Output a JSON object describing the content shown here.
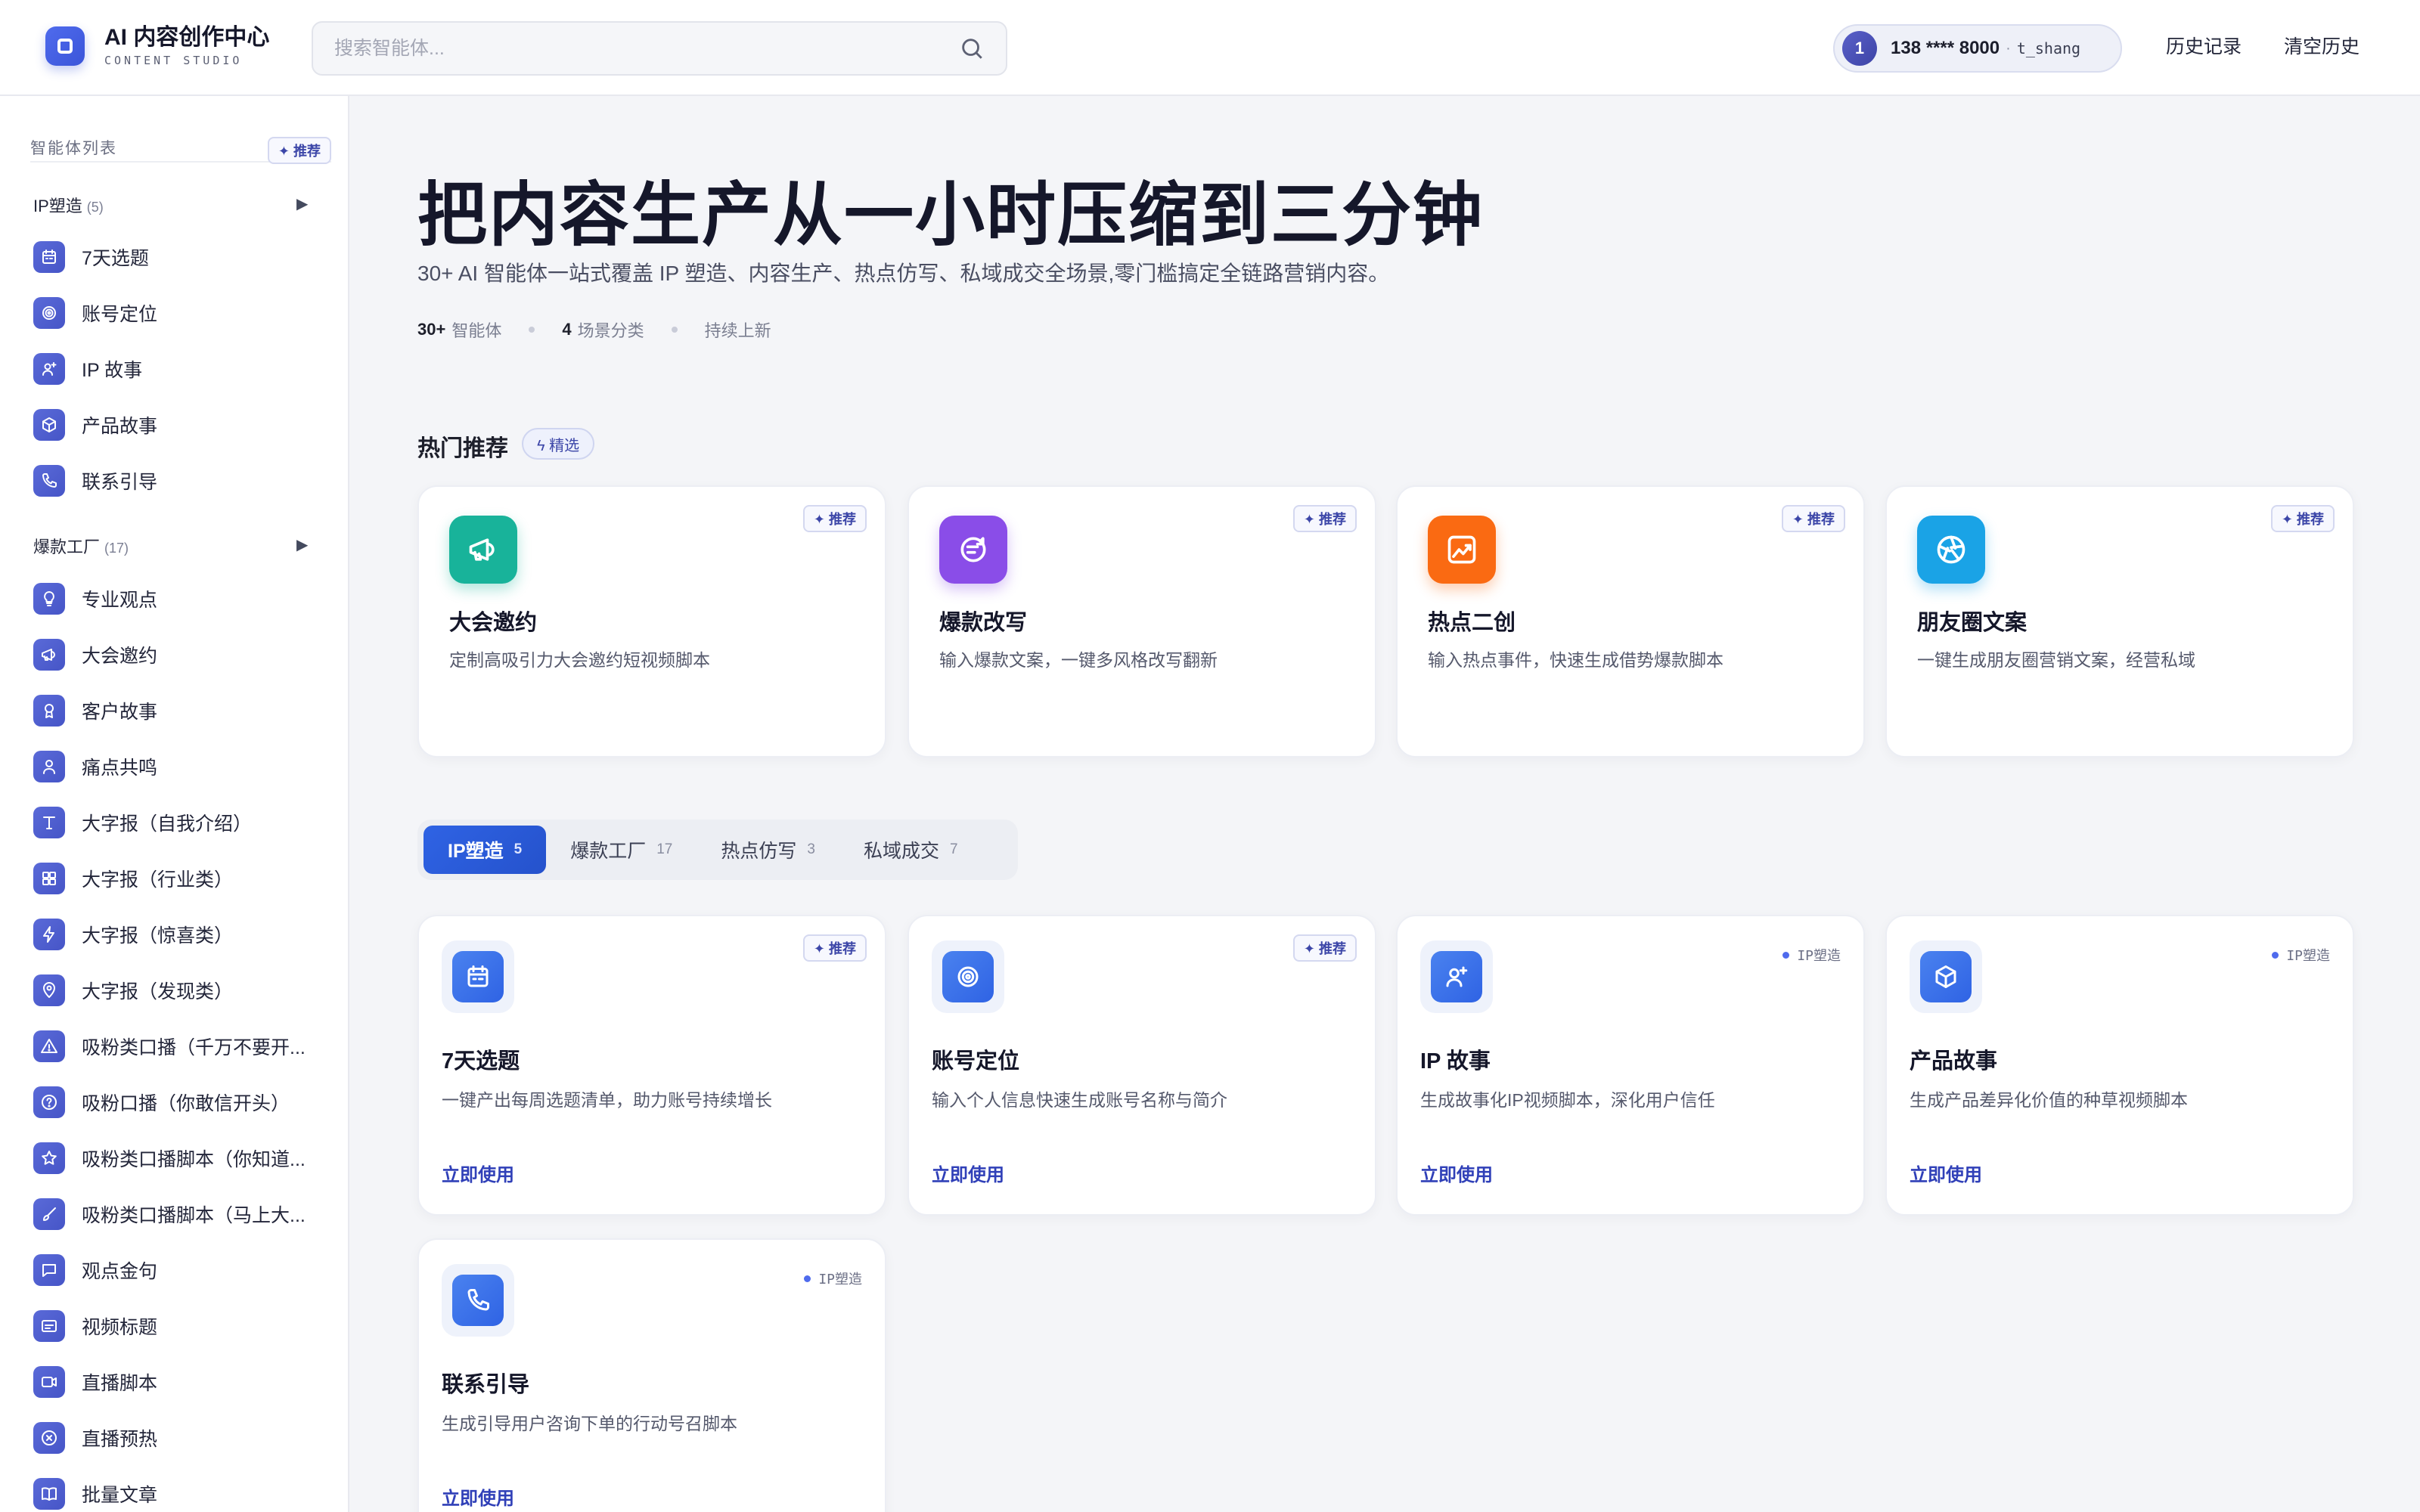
{
  "header": {
    "title": "AI 内容创作中心",
    "subtitle": "CONTENT STUDIO",
    "search_placeholder": "搜索智能体...",
    "user": {
      "avatar": "1",
      "phone": "138 **** 8000",
      "sep": "·",
      "name": "t_shang"
    },
    "history_label": "历史记录",
    "clear_label": "清空历史"
  },
  "sidebar": {
    "header_label": "智能体列表",
    "rec_label": "✦ 推荐",
    "groups": [
      {
        "label": "IP塑造",
        "count": "(5)",
        "arrow": "▶"
      },
      {
        "label": "爆款工厂",
        "count": "(17)",
        "arrow": "▶"
      }
    ],
    "ip_items": [
      {
        "label": "7天选题",
        "icon": "calendar-icon"
      },
      {
        "label": "账号定位",
        "icon": "target-icon"
      },
      {
        "label": "IP 故事",
        "icon": "user-plus-icon"
      },
      {
        "label": "产品故事",
        "icon": "box-icon"
      },
      {
        "label": "联系引导",
        "icon": "phone-icon"
      }
    ],
    "viral_items": [
      {
        "label": "专业观点",
        "icon": "bulb-icon"
      },
      {
        "label": "大会邀约",
        "icon": "megaphone-icon"
      },
      {
        "label": "客户故事",
        "icon": "award-icon"
      },
      {
        "label": "痛点共鸣",
        "icon": "person-icon"
      },
      {
        "label": "大字报（自我介绍）",
        "icon": "text-icon"
      },
      {
        "label": "大字报（行业类）",
        "icon": "grid-icon"
      },
      {
        "label": "大字报（惊喜类）",
        "icon": "bolt-icon"
      },
      {
        "label": "大字报（发现类）",
        "icon": "pin-icon"
      },
      {
        "label": "吸粉类口播（千万不要开...",
        "icon": "warning-icon"
      },
      {
        "label": "吸粉口播（你敢信开头）",
        "icon": "question-icon"
      },
      {
        "label": "吸粉类口播脚本（你知道...",
        "icon": "star-icon"
      },
      {
        "label": "吸粉类口播脚本（马上大...",
        "icon": "brush-icon"
      },
      {
        "label": "观点金句",
        "icon": "chat-icon"
      },
      {
        "label": "视频标题",
        "icon": "caption-icon"
      },
      {
        "label": "直播脚本",
        "icon": "video-icon"
      },
      {
        "label": "直播预热",
        "icon": "cancel-circle-icon"
      },
      {
        "label": "批量文章",
        "icon": "book-icon"
      }
    ]
  },
  "hero": {
    "title": "把内容生产从一小时压缩到三分钟",
    "subtitle": "30+ AI 智能体一站式覆盖 IP 塑造、内容生产、热点仿写、私域成交全场景,零门槛搞定全链路营销内容。",
    "stat1_value": "30+",
    "stat1_label": "智能体",
    "stat2_value": "4",
    "stat2_label": "场景分类",
    "stat3_label": "持续上新"
  },
  "hot": {
    "title": "热门推荐",
    "badge": "ϟ 精选",
    "rec_label": "✦ 推荐",
    "cards": [
      {
        "title": "大会邀约",
        "desc": "定制高吸引力大会邀约短视频脚本",
        "icon": "megaphone-icon",
        "color": "#18b39a"
      },
      {
        "title": "爆款改写",
        "desc": "输入爆款文案，一键多风格改写翻新",
        "icon": "rewrite-icon",
        "color": "#8a4de8"
      },
      {
        "title": "热点二创",
        "desc": "输入热点事件，快速生成借势爆款脚本",
        "icon": "trend-icon",
        "color": "#fa6a12"
      },
      {
        "title": "朋友圈文案",
        "desc": "一键生成朋友圈营销文案，经营私域",
        "icon": "aperture-icon",
        "color": "#1aa3e6"
      }
    ]
  },
  "tabs": [
    {
      "label": "IP塑造",
      "count": "5"
    },
    {
      "label": "爆款工厂",
      "count": "17"
    },
    {
      "label": "热点仿写",
      "count": "3"
    },
    {
      "label": "私域成交",
      "count": "7"
    }
  ],
  "agents": {
    "use_label": "立即使用",
    "rec_label": "✦ 推荐",
    "cat_label": "IP塑造",
    "cards": [
      {
        "title": "7天选题",
        "desc": "一键产出每周选题清单，助力账号持续增长",
        "icon": "calendar-icon"
      },
      {
        "title": "账号定位",
        "desc": "输入个人信息快速生成账号名称与简介",
        "icon": "target-icon"
      },
      {
        "title": "IP 故事",
        "desc": "生成故事化IP视频脚本，深化用户信任",
        "icon": "user-plus-icon"
      },
      {
        "title": "产品故事",
        "desc": "生成产品差异化价值的种草视频脚本",
        "icon": "box-icon"
      },
      {
        "title": "联系引导",
        "desc": "生成引导用户咨询下单的行动号召脚本",
        "icon": "phone-icon"
      }
    ]
  }
}
